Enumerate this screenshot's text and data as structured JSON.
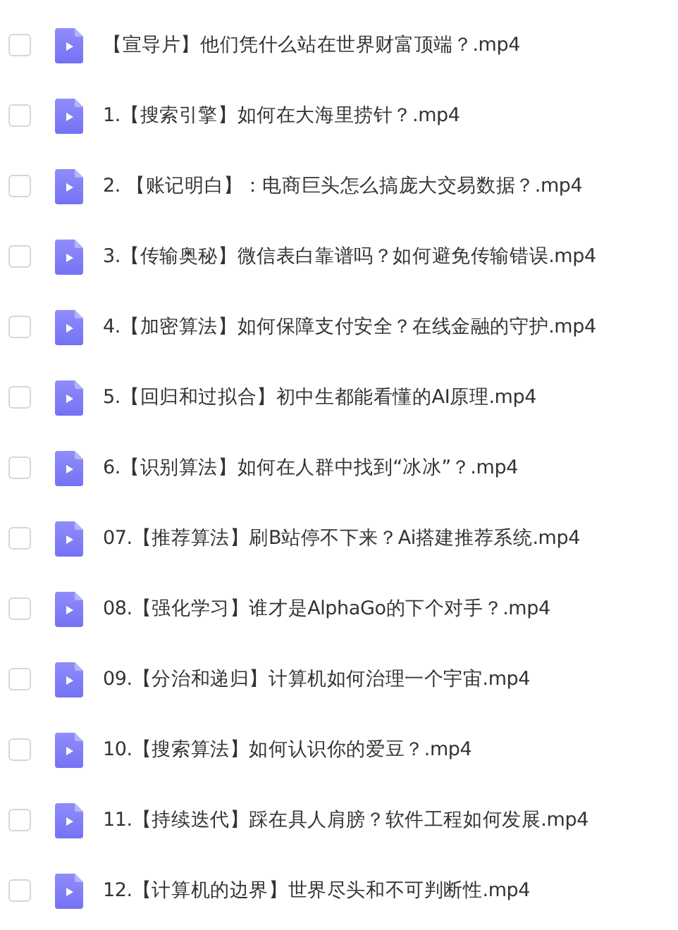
{
  "files": [
    {
      "name": "【宣导片】他们凭什么站在世界财富顶端？.mp4",
      "checked": false
    },
    {
      "name": "1.【搜索引擎】如何在大海里捞针？.mp4",
      "checked": false
    },
    {
      "name": "2. 【账记明白】：电商巨头怎么搞庞大交易数据？.mp4",
      "checked": false
    },
    {
      "name": "3.【传输奥秘】微信表白靠谱吗？如何避免传输错误.mp4",
      "checked": false
    },
    {
      "name": "4.【加密算法】如何保障支付安全？在线金融的守护.mp4",
      "checked": false
    },
    {
      "name": "5.【回归和过拟合】初中生都能看懂的AI原理.mp4",
      "checked": false
    },
    {
      "name": "6.【识别算法】如何在人群中找到“冰冰”？.mp4",
      "checked": false
    },
    {
      "name": "07.【推荐算法】刷B站停不下来？Ai搭建推荐系统.mp4",
      "checked": false
    },
    {
      "name": "08.【强化学习】谁才是AlphaGo的下个对手？.mp4",
      "checked": false
    },
    {
      "name": "09.【分治和递归】计算机如何治理一个宇宙.mp4",
      "checked": false
    },
    {
      "name": "10.【搜索算法】如何认识你的爱豆？.mp4",
      "checked": false
    },
    {
      "name": "11.【持续迭代】踩在具人肩膀？软件工程如何发展.mp4",
      "checked": false
    },
    {
      "name": "12.【计算机的边界】世界尽头和不可判断性.mp4",
      "checked": false
    }
  ]
}
